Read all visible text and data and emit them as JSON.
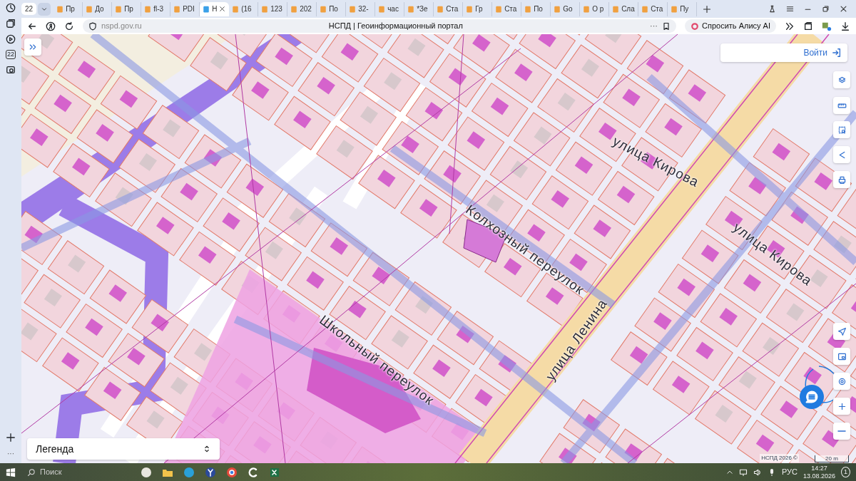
{
  "browser": {
    "sidebar_badge": "22",
    "tab_group": "22",
    "tabs": [
      {
        "label": "Пр",
        "selected": false
      },
      {
        "label": "До",
        "selected": false
      },
      {
        "label": "Пр",
        "selected": false
      },
      {
        "label": "fl-3",
        "selected": false
      },
      {
        "label": "PDI",
        "selected": false
      },
      {
        "label": "Н",
        "selected": true
      },
      {
        "label": "(16",
        "selected": false
      },
      {
        "label": "123",
        "selected": false
      },
      {
        "label": "202",
        "selected": false
      },
      {
        "label": "По",
        "selected": false
      },
      {
        "label": "32-",
        "selected": false
      },
      {
        "label": "час",
        "selected": false
      },
      {
        "label": "*Зе",
        "selected": false
      },
      {
        "label": "Ста",
        "selected": false
      },
      {
        "label": "Гр",
        "selected": false
      },
      {
        "label": "Ста",
        "selected": false
      },
      {
        "label": "По",
        "selected": false
      },
      {
        "label": "Go",
        "selected": false
      },
      {
        "label": "О р",
        "selected": false
      },
      {
        "label": "Сла",
        "selected": false
      },
      {
        "label": "Ста",
        "selected": false
      },
      {
        "label": "Пу",
        "selected": false
      }
    ],
    "address": "nspd.gov.ru",
    "page_title": "НСПД | Геоинформационный портал",
    "more": "···",
    "alice_button": "Спросить Алису AI",
    "sidebar_more": "···"
  },
  "map": {
    "login_button": "Войти",
    "street_labels": [
      {
        "text": "улица Кирова"
      },
      {
        "text": "улица Кирова"
      },
      {
        "text": "Колхозный переулок"
      },
      {
        "text": "улица Ленина"
      },
      {
        "text": "Школьный переулок"
      }
    ],
    "legend": "Легенда",
    "attribution": "НСПД 2026 ©",
    "scale": "20 m"
  },
  "taskbar": {
    "search_placeholder": "Поиск",
    "language": "РУС",
    "time": "14:27",
    "date": "13.08.2026",
    "notifications": "1"
  }
}
